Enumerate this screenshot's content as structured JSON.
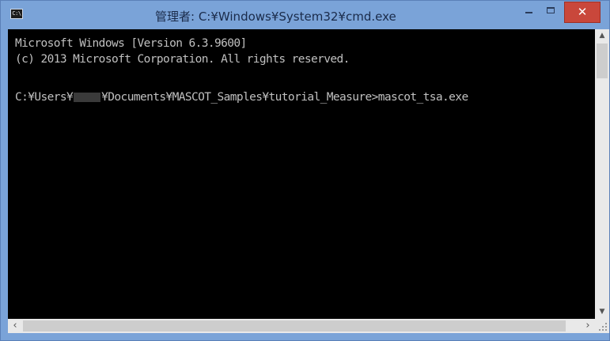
{
  "window": {
    "title": "管理者: C:¥Windows¥System32¥cmd.exe",
    "icon_label": "C:\\",
    "icon": "console-icon",
    "controls": {
      "minimize_icon": "minimize-icon",
      "maximize_icon": "maximize-icon",
      "close_icon": "close-icon",
      "close_symbol": "✕"
    },
    "colors": {
      "frame": "#7aa3d8",
      "close_button": "#c9473b",
      "console_background": "#000000",
      "console_text": "#c0c0c0"
    }
  },
  "console": {
    "lines": [
      "Microsoft Windows [Version 6.3.9600]",
      "(c) 2013 Microsoft Corporation. All rights reserved."
    ],
    "prompt_prefix": "C:¥Users¥",
    "prompt_suffix": "¥Documents¥MASCOT_Samples¥tutorial_Measure>mascot_tsa.exe"
  },
  "scrollbars": {
    "up_arrow": "▲",
    "down_arrow": "▼",
    "left_arrow": "‹",
    "right_arrow": "›"
  }
}
